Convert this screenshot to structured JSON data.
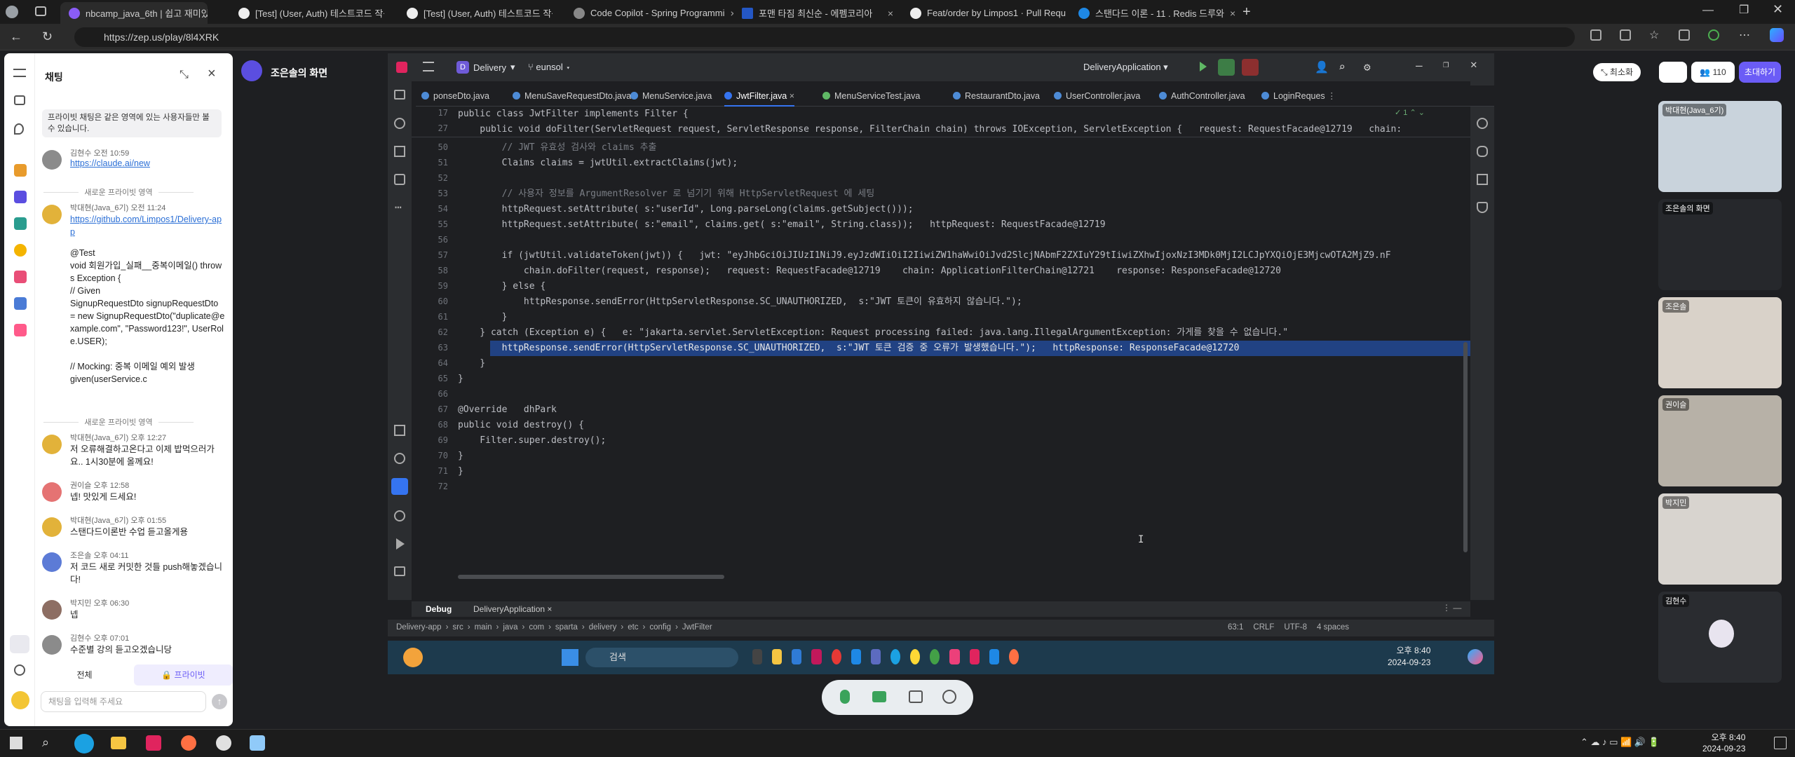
{
  "browser": {
    "tabs": [
      {
        "label": "nbcamp_java_6th | 쉽고 재미있",
        "active": true
      },
      {
        "label": "[Test] (User, Auth) 테스트코드 작성"
      },
      {
        "label": "[Test] (User, Auth) 테스트코드 작성"
      },
      {
        "label": "Code Copilot - Spring Programmi"
      },
      {
        "label": "포맨 타짐 최신순 - 에펨코리아"
      },
      {
        "label": "Feat/order by Limpos1 · Pull Requ"
      },
      {
        "label": "스탠다드 이론 - 11 . Redis 드루와"
      }
    ],
    "url": "https://zep.us/play/8l4XRK"
  },
  "zep": {
    "screen_title": "조은솔의 화면",
    "minimize_label": "최소화",
    "invite_label": "초대하기",
    "participant_count": "110",
    "chat": {
      "title": "채팅",
      "notice": "프라이빗 채팅은 같은 영역에 있는 사용자들만 볼 수 있습니다.",
      "divider_label": "새로운 프라이빗 영역",
      "messages": [
        {
          "name": "김현수",
          "time": "오전 10:59",
          "text": "https://claude.ai/new",
          "link": true,
          "color": "#8b8b8b"
        },
        {
          "name": "박대현(Java_6기)",
          "time": "오전 11:24",
          "text": "https://github.com/Limpos1/Delivery-app",
          "link": true,
          "color": "#e2b23a"
        },
        {
          "name": "",
          "time": "",
          "text": "@Test\nvoid 회원가입_실패__중복이메일() throws Exception {\n// Given\nSignupRequestDto signupRequestDto = new SignupRequestDto(\"duplicate@example.com\", \"Password123!\", UserRole.USER);\n\n// Mocking: 중복 이메일 예외 발생\ngiven(userService.c",
          "link": false,
          "color": ""
        },
        {
          "name": "박대현(Java_6기)",
          "time": "오후 12:27",
          "text": "저 오류해결하고온다고 이제 밥먹으러가요.. 1시30분에 올께요!",
          "link": false,
          "color": "#e2b23a"
        },
        {
          "name": "권이슬",
          "time": "오후 12:58",
          "text": "넵! 맛있게 드세요!",
          "link": false,
          "color": "#e57373"
        },
        {
          "name": "박대현(Java_6기)",
          "time": "오후 01:55",
          "text": "스탠다드이론반 수업 듣고올게용",
          "link": false,
          "color": "#e2b23a"
        },
        {
          "name": "조은솔",
          "time": "오후 04:11",
          "text": "저 코드 새로 커밋한 것들 push해놓겠습니다!",
          "link": false,
          "color": "#5c7bd6"
        },
        {
          "name": "박지민",
          "time": "오후 06:30",
          "text": "넵",
          "link": false,
          "color": "#8d6e63"
        },
        {
          "name": "김현수",
          "time": "오후 07:01",
          "text": "수준별 강의 듣고오겠습니당",
          "link": false,
          "color": "#8b8b8b"
        }
      ],
      "tab_all": "전체",
      "tab_private": "프라이빗",
      "input_placeholder": "채팅을 입력해 주세요"
    },
    "participants": [
      "박대현(Java_6기)",
      "조은솔의 화면",
      "조은솔",
      "권이슬",
      "박지민",
      "김현수"
    ]
  },
  "ide": {
    "project": "Delivery",
    "branch": "eunsol",
    "run_config": "DeliveryApplication",
    "tabs": [
      "ponseDto.java",
      "MenuSaveRequestDto.java",
      "MenuService.java",
      "JwtFilter.java",
      "MenuServiceTest.java",
      "RestaurantDto.java",
      "UserController.java",
      "AuthController.java",
      "LoginReques"
    ],
    "active_tab": "JwtFilter.java",
    "sticky": [
      {
        "ln": "17",
        "code": "public class JwtFilter implements Filter {"
      },
      {
        "ln": "27",
        "code": "    public void doFilter(ServletRequest request, ServletResponse response, FilterChain chain) throws IOException, ServletException {   request: RequestFacade@12719   chain:"
      }
    ],
    "lines": [
      {
        "ln": "50",
        "code": "        // JWT 유효성 검사와 claims 추출"
      },
      {
        "ln": "51",
        "code": "        Claims claims = jwtUtil.extractClaims(jwt);"
      },
      {
        "ln": "52",
        "code": ""
      },
      {
        "ln": "53",
        "code": "        // 사용자 정보를 ArgumentResolver 로 넘기기 위해 HttpServletRequest 에 세팅"
      },
      {
        "ln": "54",
        "code": "        httpRequest.setAttribute( s:\"userId\", Long.parseLong(claims.getSubject()));"
      },
      {
        "ln": "55",
        "code": "        httpRequest.setAttribute( s:\"email\", claims.get( s:\"email\", String.class));   httpRequest: RequestFacade@12719"
      },
      {
        "ln": "56",
        "code": ""
      },
      {
        "ln": "57",
        "code": "        if (jwtUtil.validateToken(jwt)) {   jwt: \"eyJhbGciOiJIUzI1NiJ9.eyJzdWIiOiI2IiwiZW1haWwiOiJvd2SlcjNAbmF2ZXIuY29tIiwiZXhwIjoxNzI3MDk0MjI2LCJpYXQiOjE3MjcwOTA2MjZ9.nF"
      },
      {
        "ln": "58",
        "code": "            chain.doFilter(request, response);   request: RequestFacade@12719    chain: ApplicationFilterChain@12721    response: ResponseFacade@12720"
      },
      {
        "ln": "59",
        "code": "        } else {"
      },
      {
        "ln": "60",
        "code": "            httpResponse.sendError(HttpServletResponse.SC_UNAUTHORIZED,  s:\"JWT 토큰이 유효하지 않습니다.\");"
      },
      {
        "ln": "61",
        "code": "        }"
      },
      {
        "ln": "62",
        "code": "    } catch (Exception e) {   e: \"jakarta.servlet.ServletException: Request processing failed: java.lang.IllegalArgumentException: 가게를 찾을 수 없습니다.\""
      },
      {
        "ln": "63",
        "code": "        httpResponse.sendError(HttpServletResponse.SC_UNAUTHORIZED,  s:\"JWT 토큰 검증 중 오류가 발생했습니다.\");   httpResponse: ResponseFacade@12720"
      },
      {
        "ln": "64",
        "code": "    }"
      },
      {
        "ln": "65",
        "code": "}"
      },
      {
        "ln": "66",
        "code": ""
      },
      {
        "ln": "67",
        "code": "@Override   dhPark"
      },
      {
        "ln": "68",
        "code": "public void destroy() {"
      },
      {
        "ln": "69",
        "code": "    Filter.super.destroy();"
      },
      {
        "ln": "70",
        "code": "}"
      },
      {
        "ln": "71",
        "code": "}"
      },
      {
        "ln": "72",
        "code": ""
      }
    ],
    "highlight_line": "63",
    "bottom_tabs": [
      "Debug",
      "DeliveryApplication"
    ],
    "breadcrumb": [
      "Delivery-app",
      "src",
      "main",
      "java",
      "com",
      "sparta",
      "delivery",
      "etc",
      "config",
      "JwtFilter"
    ],
    "status": {
      "pos": "63:1",
      "eol": "CRLF",
      "enc": "UTF-8",
      "indent": "4 spaces"
    },
    "inspection": "1"
  },
  "shared_taskbar": {
    "search": "검색",
    "time": "오후 8:40",
    "date": "2024-09-23"
  },
  "windows_taskbar": {
    "time": "오후 8:40",
    "date": "2024-09-23"
  }
}
